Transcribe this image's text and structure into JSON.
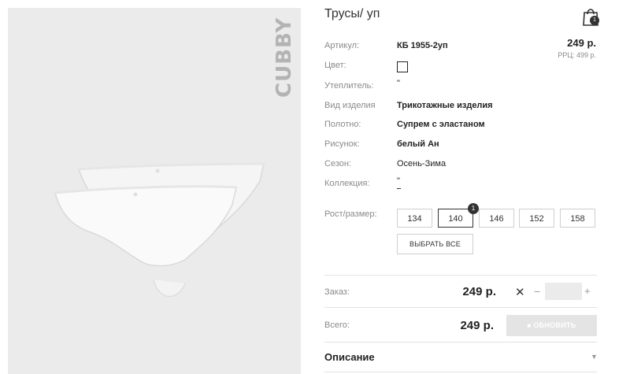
{
  "product": {
    "title": "Трусы/ уп",
    "brand": "CUBBY",
    "price": "249 р.",
    "rrp": "РРЦ: 499 р."
  },
  "cart": {
    "icon": "shopping-bag-icon",
    "count": "1"
  },
  "specs": [
    {
      "label": "Артикул:",
      "value": "КБ 1955-2уп"
    },
    {
      "label": "Цвет:",
      "value": ""
    },
    {
      "label": "Утеплитель:",
      "value": "\""
    },
    {
      "label": "Вид изделия",
      "value": "Трикотажные изделия"
    },
    {
      "label": "Полотно:",
      "value": "Супрем с эластаном"
    },
    {
      "label": "Рисунок:",
      "value": "белый Ан"
    },
    {
      "label": "Сезон:",
      "value": "Осень-Зима"
    },
    {
      "label": "Коллекция:",
      "value": "\""
    }
  ],
  "sizes": {
    "label": "Рост/размер:",
    "options": [
      "134",
      "140",
      "146",
      "152",
      "158"
    ],
    "selected": "140",
    "selected_count": "1",
    "select_all": "ВЫБРАТЬ ВСЕ"
  },
  "order": {
    "label": "Заказ:",
    "price": "249 р.",
    "remove": "✕",
    "minus": "−",
    "plus": "+",
    "qty": ""
  },
  "total": {
    "label": "Всего:",
    "price": "249 р.",
    "update": "ОБНОВИТЬ"
  },
  "description": {
    "label": "Описание",
    "arrow": "▼"
  }
}
